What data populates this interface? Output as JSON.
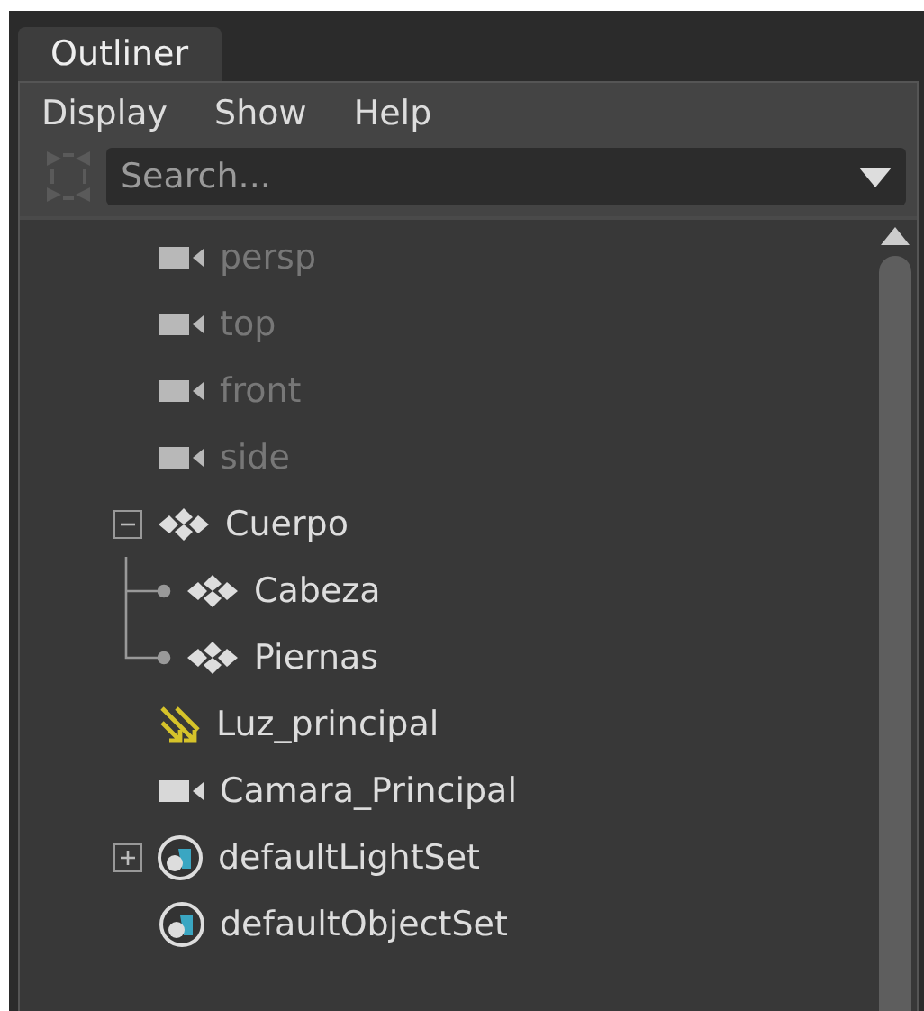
{
  "tab": {
    "label": "Outliner",
    "selected": true
  },
  "menu": [
    "Display",
    "Show",
    "Help"
  ],
  "search": {
    "placeholder": "Search..."
  },
  "tree": [
    {
      "label": "persp",
      "kind": "camera",
      "dimmed": true
    },
    {
      "label": "top",
      "kind": "camera",
      "dimmed": true
    },
    {
      "label": "front",
      "kind": "camera",
      "dimmed": true
    },
    {
      "label": "side",
      "kind": "camera",
      "dimmed": true
    },
    {
      "label": "Cuerpo",
      "kind": "group",
      "dimmed": false,
      "expanded": true,
      "children": [
        {
          "label": "Cabeza",
          "kind": "group",
          "dimmed": false
        },
        {
          "label": "Piernas",
          "kind": "group",
          "dimmed": false
        }
      ]
    },
    {
      "label": "Luz_principal",
      "kind": "light",
      "dimmed": false
    },
    {
      "label": "Camara_Principal",
      "kind": "camera",
      "dimmed": false
    },
    {
      "label": "defaultLightSet",
      "kind": "set",
      "dimmed": false,
      "expanded": false
    },
    {
      "label": "defaultObjectSet",
      "kind": "set",
      "dimmed": false
    }
  ]
}
